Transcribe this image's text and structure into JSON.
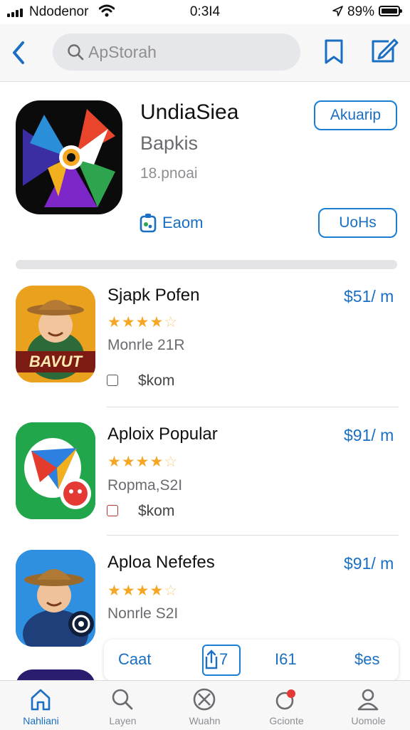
{
  "status_bar": {
    "carrier": "Ndodenor",
    "time": "0:3I4",
    "battery": "89%"
  },
  "nav": {
    "search_placeholder": "ApStorah"
  },
  "featured": {
    "title": "UndiaSiea",
    "subtitle": "Bapkis",
    "meta": "18.pnoai",
    "primary_button": "Akuarip",
    "link_label": "Eaom",
    "secondary_button": "UoHs"
  },
  "apps": [
    {
      "title": "Sjapk Pofen",
      "price": "$51/ m",
      "rating": 4,
      "meta": "Monrle 21R",
      "small_text": "$kom",
      "icon_text": "BAVUT"
    },
    {
      "title": "Aploix Popular",
      "price": "$91/ m",
      "rating": 4,
      "meta": "Ropma,S2I",
      "small_text": "$kom"
    },
    {
      "title": "Aploa Nefefes",
      "price": "$91/ m",
      "rating": 4,
      "meta": "Nonrle S2I"
    }
  ],
  "float_bar": {
    "items": [
      "Caat",
      "7",
      "I61",
      "$es"
    ]
  },
  "tabs": [
    {
      "label": "Nahliani",
      "icon": "home-icon",
      "active": true
    },
    {
      "label": "Layen",
      "icon": "search-icon"
    },
    {
      "label": "Wuahn",
      "icon": "compass-icon"
    },
    {
      "label": "Gcionte",
      "icon": "game-icon"
    },
    {
      "label": "Uomole",
      "icon": "person-icon"
    }
  ],
  "colors": {
    "accent": "#1a6fc2",
    "star": "#f5a623"
  }
}
